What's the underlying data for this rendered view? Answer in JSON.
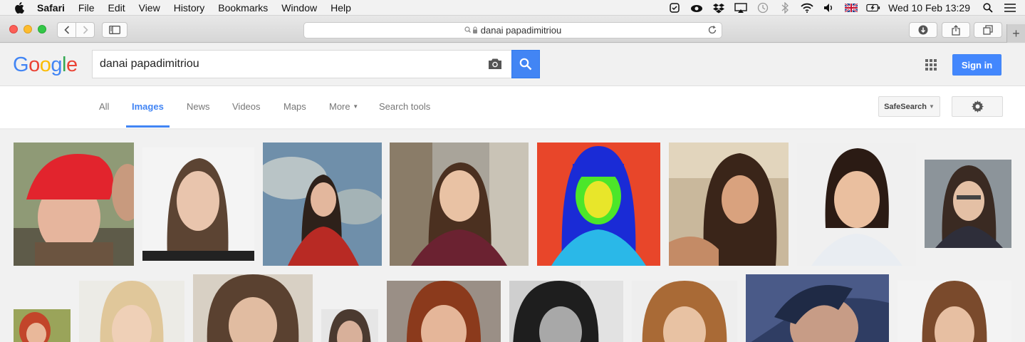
{
  "menubar": {
    "items": [
      "Safari",
      "File",
      "Edit",
      "View",
      "History",
      "Bookmarks",
      "Window",
      "Help"
    ],
    "clock": "Wed 10 Feb  13:29"
  },
  "browser": {
    "address": "danai papadimitriou"
  },
  "google": {
    "query": "danai papadimitriou",
    "signin_label": "Sign in",
    "tabs": [
      "All",
      "Images",
      "News",
      "Videos",
      "Maps",
      "More",
      "Search tools"
    ],
    "safesearch_label": "SafeSearch"
  },
  "colors": {
    "accent": "#4285f4",
    "signin_bg": "#4387fd"
  },
  "icons": [
    "apple-icon",
    "back-icon",
    "forward-icon",
    "sidebar-icon",
    "lock-icon",
    "reload-icon",
    "download-icon",
    "share-icon",
    "tabs-icon",
    "camera-icon",
    "search-icon",
    "apps-icon",
    "gear-icon"
  ]
}
